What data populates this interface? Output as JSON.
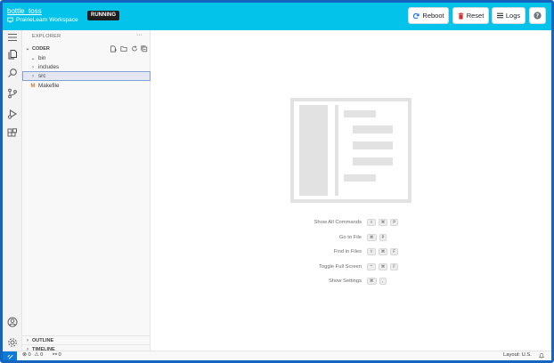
{
  "header": {
    "project_title": "bottle_toss",
    "workspace_label": "PrairieLearn Workspace",
    "status_badge": "RUNNING",
    "buttons": {
      "reboot": "Reboot",
      "reset": "Reset",
      "logs": "Logs"
    },
    "colors": {
      "bar": "#03c3ea",
      "reset_icon": "#d32f2f",
      "reboot_icon": "#0d6efd"
    }
  },
  "activity_bar": {
    "icons": [
      "menu-icon",
      "files-icon",
      "search-icon",
      "source-control-icon",
      "run-debug-icon",
      "extensions-icon",
      "account-icon",
      "manage-icon"
    ]
  },
  "sidebar": {
    "title": "EXPLORER",
    "more": "···",
    "section": "CODER",
    "tree": [
      {
        "label": "bin",
        "expanded": true
      },
      {
        "label": "includes",
        "expanded": false
      },
      {
        "label": "src",
        "expanded": false,
        "selected": true
      },
      {
        "label": "Makefile",
        "icon": "M"
      }
    ],
    "outline": "OUTLINE",
    "timeline": "TIMELINE"
  },
  "editor": {
    "shortcuts": [
      {
        "label": "Show All Commands",
        "keys": [
          "⇧",
          "⌘",
          "P"
        ]
      },
      {
        "label": "Go to File",
        "keys": [
          "⌘",
          "P"
        ]
      },
      {
        "label": "Find in Files",
        "keys": [
          "⇧",
          "⌘",
          "F"
        ]
      },
      {
        "label": "Toggle Full Screen",
        "keys": [
          "^",
          "⌘",
          "F"
        ]
      },
      {
        "label": "Show Settings",
        "keys": [
          "⌘",
          ","
        ]
      }
    ]
  },
  "statusbar": {
    "errors": "0",
    "warnings": "0",
    "ports": "0",
    "layout": "Layout: U.S."
  }
}
